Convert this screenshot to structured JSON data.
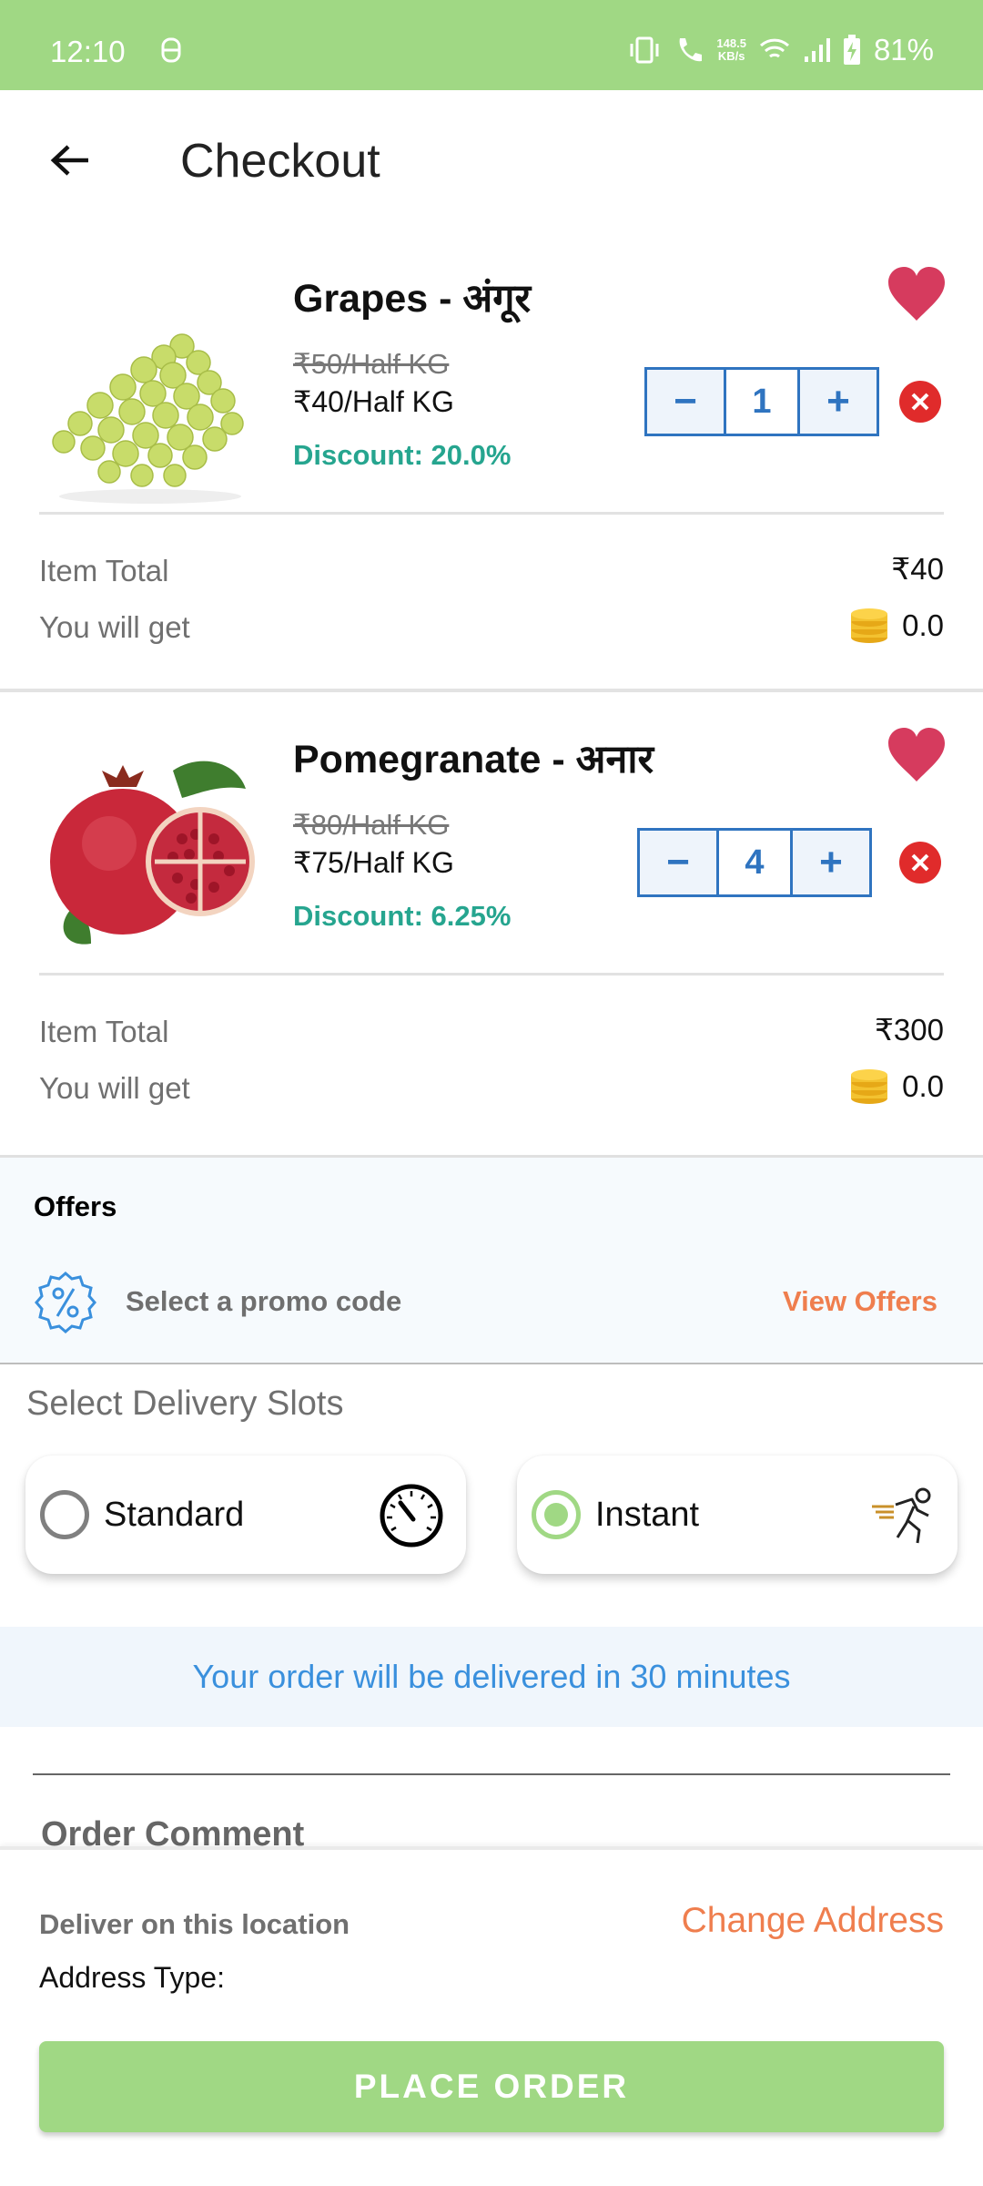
{
  "status_bar": {
    "time": "12:10",
    "net_speed_value": "148.5",
    "net_speed_unit": "KB/s",
    "battery": "81%"
  },
  "header": {
    "title": "Checkout",
    "back_icon": "arrow-left-icon"
  },
  "items": [
    {
      "name": "Grapes - अंगूर",
      "old_price": "₹50/Half KG",
      "price": "₹40/Half KG",
      "discount": "Discount: 20.0%",
      "quantity": "1",
      "item_total_label": "Item Total",
      "item_total": "₹40",
      "reward_label": "You will get",
      "reward": "0.0",
      "favorite": true
    },
    {
      "name": "Pomegranate - अनार",
      "old_price": "₹80/Half KG",
      "price": "₹75/Half KG",
      "discount": "Discount: 6.25%",
      "quantity": "4",
      "item_total_label": "Item Total",
      "item_total": "₹300",
      "reward_label": "You will get",
      "reward": "0.0",
      "favorite": true
    }
  ],
  "stepper": {
    "minus": "−",
    "plus": "+"
  },
  "offers": {
    "title": "Offers",
    "promo_placeholder": "Select a promo code",
    "view_offers": "View Offers"
  },
  "delivery": {
    "title": "Select Delivery Slots",
    "slots": [
      {
        "label": "Standard",
        "selected": false,
        "icon": "speedometer-icon"
      },
      {
        "label": "Instant",
        "selected": true,
        "icon": "running-man-icon"
      }
    ],
    "eta_message": "Your order will be delivered in 30 minutes"
  },
  "order_comment": {
    "label": "Order Comment"
  },
  "address": {
    "deliver_label": "Deliver on this location",
    "change_label": "Change Address",
    "address_type_label": "Address Type:"
  },
  "place_order": {
    "label": "PLACE ORDER"
  },
  "colors": {
    "brand_green": "#a0d884",
    "accent_orange": "#ef7e4e",
    "stepper_blue": "#2f74c0",
    "discount_teal": "#26a58f",
    "heart_red": "#d63b5e",
    "eta_blue": "#3a90dd"
  }
}
